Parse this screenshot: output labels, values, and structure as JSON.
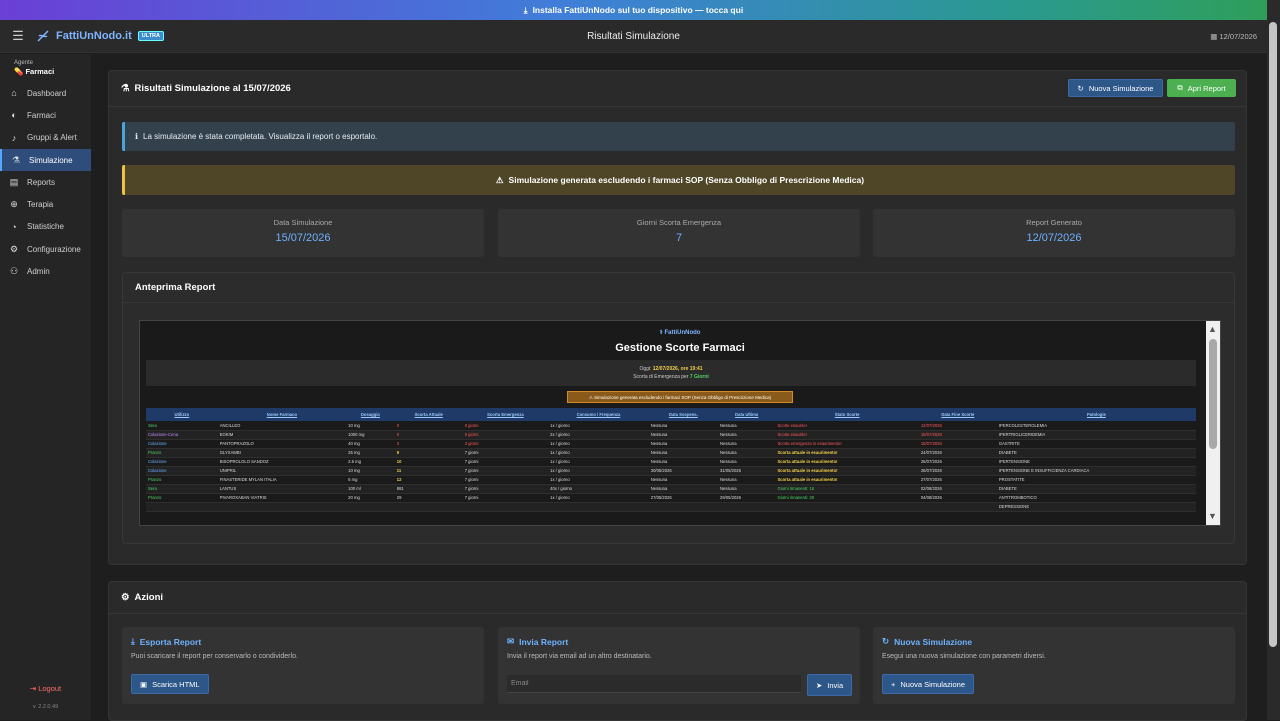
{
  "banner": {
    "text": "Installa FattiUnNodo sul tuo dispositivo — tocca qui"
  },
  "header": {
    "brand": "FattiUnNodo.it",
    "badge": "ULTRA",
    "title": "Risultati Simulazione",
    "date": "12/07/2026"
  },
  "sidebar": {
    "agent_label": "Agente",
    "agent_name": "Farmaci",
    "items": [
      {
        "label": "Dashboard",
        "icon": "home-icon"
      },
      {
        "label": "Farmaci",
        "icon": "pills-icon"
      },
      {
        "label": "Gruppi & Alert",
        "icon": "bell-icon"
      },
      {
        "label": "Simulazione",
        "icon": "flask-icon"
      },
      {
        "label": "Reports",
        "icon": "chart-icon"
      },
      {
        "label": "Terapia",
        "icon": "capsules-icon"
      },
      {
        "label": "Statistiche",
        "icon": "pie-icon"
      },
      {
        "label": "Configurazione",
        "icon": "gear-icon"
      },
      {
        "label": "Admin",
        "icon": "users-icon"
      }
    ],
    "logout": "Logout",
    "version": "v. 2.2.0.49"
  },
  "results": {
    "title": "Risultati Simulazione al 15/07/2026",
    "btn_new": "Nuova Simulazione",
    "btn_open": "Apri Report",
    "info": "La simulazione è stata completata. Visualizza il report o esportalo.",
    "warning": "Simulazione generata escludendo i farmaci SOP (Senza Obbligo di Prescrizione Medica)",
    "stats": [
      {
        "label": "Data Simulazione",
        "value": "15/07/2026"
      },
      {
        "label": "Giorni Scorta Emergenza",
        "value": "7"
      },
      {
        "label": "Report Generato",
        "value": "12/07/2026"
      }
    ],
    "preview_title": "Anteprima Report"
  },
  "report": {
    "brand": "FattiUnNodo",
    "title": "Gestione Scorte Farmaci",
    "today_label": "Oggi:",
    "today_value": "12/07/2026, ore 19:41",
    "emerg_label": "Scorta di Emergenza per",
    "emerg_value": "7 Giorni",
    "warning": "⚠ Simulazione generata escludendo i farmaci SOP (Senza Obbligo di Prescrizione Medica)",
    "columns": [
      "Utilizzo",
      "Nome Farmaco",
      "Dosaggio",
      "Scorta Attuale",
      "Scorta Emergenza",
      "Consumo / Frequenza",
      "Data Sospens.",
      "Data Ultimo",
      "Stato Scorte",
      "Data Fine Scorte",
      "Patologie"
    ],
    "rows": [
      [
        "Sera",
        "ANCILLEO",
        "10 mg",
        "0",
        "0 giorni",
        "1x / giorno",
        "Nessuna",
        "Nessuna",
        "Scorte esaurite!",
        "12/07/2026",
        "IPERCOLESTEROLEMIA"
      ],
      [
        "Colazione-Cena",
        "EOKIM",
        "1000 mg",
        "0",
        "0 giorni",
        "2x / giorno",
        "Nessuna",
        "Nessuna",
        "Scorte esaurite!",
        "15/07/2026",
        "IPERTRIGLICERIDEMIA"
      ],
      [
        "Colazione",
        "PANTOPRAZOLO",
        "40 mg",
        "3",
        "3 giorni",
        "1x / giorno",
        "Nessuna",
        "Nessuna",
        "Scorta emergenza in esaurimento!",
        "15/07/2026",
        "GASTRITE"
      ],
      [
        "Pranzo",
        "GLYXAMBI",
        "25 mg",
        "9",
        "7 giorni",
        "1x / giorno",
        "Nessuna",
        "Nessuna",
        "Scorta attuale in esaurimento!",
        "24/07/2026",
        "DIABETE"
      ],
      [
        "Colazione",
        "BISOPROLOLO SANDOZ",
        "2.5 mg",
        "10",
        "7 giorni",
        "1x / giorno",
        "Nessuna",
        "Nessuna",
        "Scorta attuale in esaurimento!",
        "25/07/2026",
        "IPERTENSIONE"
      ],
      [
        "Colazione",
        "UNIPRIL",
        "10 mg",
        "11",
        "7 giorni",
        "1x / giorno",
        "30/05/2026",
        "31/05/2026",
        "Scorta attuale in esaurimento!",
        "26/07/2026",
        "IPERTENSIONE E INSUFFICIENZA CARDIACA"
      ],
      [
        "Pranzo",
        "FINASTERIDE MYLAN ITALIA",
        "5 mg",
        "12",
        "7 giorni",
        "1x / giorno",
        "Nessuna",
        "Nessuna",
        "Scorta attuale in esaurimento!",
        "27/07/2026",
        "PROSTATITE"
      ],
      [
        "Sera",
        "LANTUS",
        "100 ml",
        "881",
        "7 giorni",
        "40x / giorno",
        "Nessuna",
        "Nessuna",
        "Giorni rimanenti: 16",
        "02/08/2026",
        "DIABETE"
      ],
      [
        "Pranzo",
        "PIVAROXABAN VIATRIS",
        "20 mg",
        "29",
        "7 giorni",
        "1x / giorno",
        "27/05/2026",
        "29/05/2026",
        "Giorni rimanenti: 29",
        "04/08/2026",
        "ANTITROMBOTICO"
      ],
      [
        "",
        "",
        "",
        "",
        "",
        "",
        "",
        "",
        "",
        "",
        "DEPRESSIONE"
      ]
    ]
  },
  "actions": {
    "title": "Azioni",
    "export": {
      "title": "Esporta Report",
      "desc": "Puoi scaricare il report per conservarlo o condividerlo.",
      "btn": "Scarica HTML"
    },
    "send": {
      "title": "Invia Report",
      "desc": "Invia il report via email ad un altro destinatario.",
      "placeholder": "Email",
      "btn": "Invia"
    },
    "newsim": {
      "title": "Nuova Simulazione",
      "desc": "Esegui una nuova simulazione con parametri diversi.",
      "btn": "Nuova Simulazione"
    }
  },
  "colors": {
    "accent": "#6db1ff",
    "success": "#4caf50",
    "primary": "#2d5689",
    "danger": "#ff5a5a",
    "warn": "#f2d04a"
  }
}
